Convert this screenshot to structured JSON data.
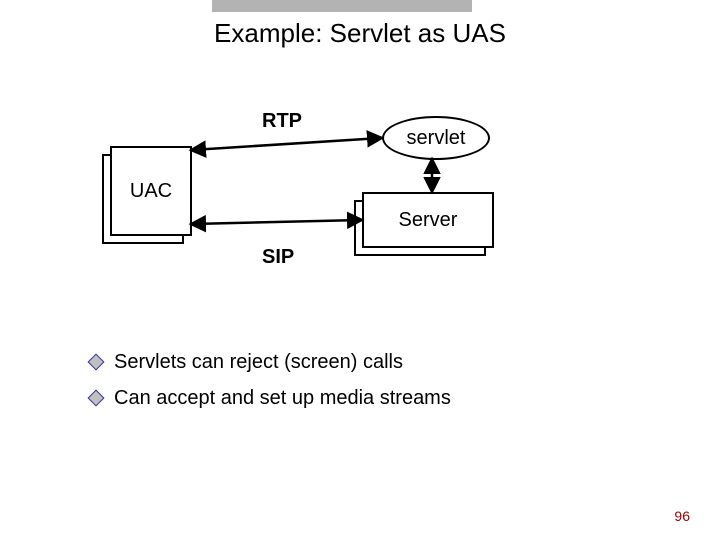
{
  "title": "Example: Servlet as UAS",
  "diagram": {
    "uac_label": "UAC",
    "servlet_label": "servlet",
    "server_label": "Server",
    "rtp_label": "RTP",
    "sip_label": "SIP"
  },
  "bullets": [
    "Servlets can reject (screen) calls",
    "Can accept and set up media streams"
  ],
  "colors": {
    "bullet_border": "#333399",
    "bullet_fill": "#c0c0c0",
    "page_num": "#990000"
  },
  "page_number": "96"
}
